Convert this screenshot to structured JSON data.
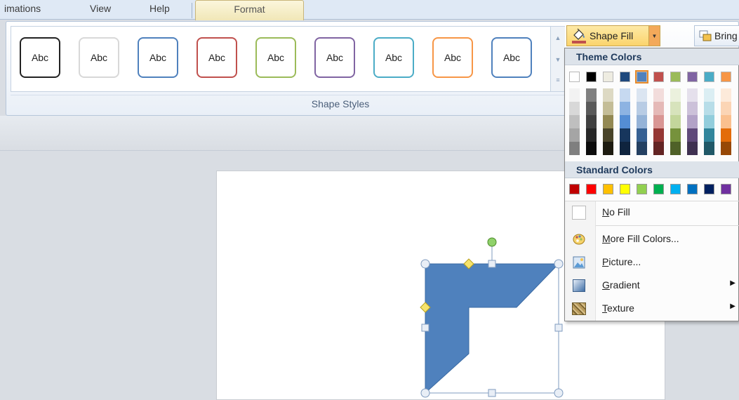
{
  "tabs": [
    {
      "label": "imations",
      "active": false
    },
    {
      "label": "View",
      "active": false
    },
    {
      "label": "Help",
      "active": false
    },
    {
      "label": "Format",
      "active": true
    }
  ],
  "shape_styles": {
    "group_label": "Shape Styles",
    "items": [
      {
        "label": "Abc",
        "border_color": "#222222"
      },
      {
        "label": "Abc",
        "border_color": "#d8d8d8"
      },
      {
        "label": "Abc",
        "border_color": "#4f81bd"
      },
      {
        "label": "Abc",
        "border_color": "#c0504d"
      },
      {
        "label": "Abc",
        "border_color": "#9bbb59"
      },
      {
        "label": "Abc",
        "border_color": "#8064a2"
      },
      {
        "label": "Abc",
        "border_color": "#4bacc6"
      },
      {
        "label": "Abc",
        "border_color": "#f79646"
      },
      {
        "label": "Abc",
        "border_color": "#4f81bd"
      }
    ]
  },
  "toolbar": {
    "shape_fill_label": "Shape Fill",
    "bring_label": "Bring"
  },
  "fill_menu": {
    "theme_header": "Theme Colors",
    "theme_base": [
      "#ffffff",
      "#000000",
      "#eeece1",
      "#1f497d",
      "#4f81bd",
      "#c0504d",
      "#9bbb59",
      "#8064a2",
      "#4bacc6",
      "#f79646"
    ],
    "selected_theme_index": 4,
    "theme_shades": [
      [
        "#f2f2f2",
        "#d8d8d8",
        "#bfbfbf",
        "#a5a5a5",
        "#7f7f7f"
      ],
      [
        "#7f7f7f",
        "#595959",
        "#3f3f3f",
        "#262626",
        "#0c0c0c"
      ],
      [
        "#ddd9c3",
        "#c4bd97",
        "#938953",
        "#494429",
        "#1d1b10"
      ],
      [
        "#c6d9f0",
        "#8db3e2",
        "#548dd4",
        "#17365d",
        "#0f243e"
      ],
      [
        "#dbe5f1",
        "#b8cce4",
        "#95b3d7",
        "#366092",
        "#244061"
      ],
      [
        "#f2dcdb",
        "#e5b9b7",
        "#d99694",
        "#953734",
        "#632423"
      ],
      [
        "#ebf1dd",
        "#d7e3bc",
        "#c3d69b",
        "#76923c",
        "#4f6128"
      ],
      [
        "#e5e0ec",
        "#ccc1d9",
        "#b2a2c7",
        "#5f497a",
        "#3f3151"
      ],
      [
        "#dbeef3",
        "#b7dde8",
        "#92cddc",
        "#31859b",
        "#205867"
      ],
      [
        "#fdeada",
        "#fbd5b5",
        "#fac08f",
        "#e36c09",
        "#974806"
      ]
    ],
    "standard_header": "Standard Colors",
    "standard_colors": [
      "#c00000",
      "#ff0000",
      "#ffc000",
      "#ffff00",
      "#92d050",
      "#00b050",
      "#00b0f0",
      "#0070c0",
      "#002060",
      "#7030a0"
    ],
    "items": [
      {
        "label": "No Fill",
        "icon": "no-fill-icon",
        "has_submenu": false
      },
      {
        "label": "More Fill Colors...",
        "icon": "palette-icon",
        "has_submenu": false
      },
      {
        "label": "Picture...",
        "icon": "picture-icon",
        "has_submenu": false
      },
      {
        "label": "Gradient",
        "icon": "gradient-icon",
        "has_submenu": true
      },
      {
        "label": "Texture",
        "icon": "texture-icon",
        "has_submenu": true
      }
    ]
  },
  "colors": {
    "shape_fill": "#4f81bd",
    "accent": "#f3a95a"
  }
}
